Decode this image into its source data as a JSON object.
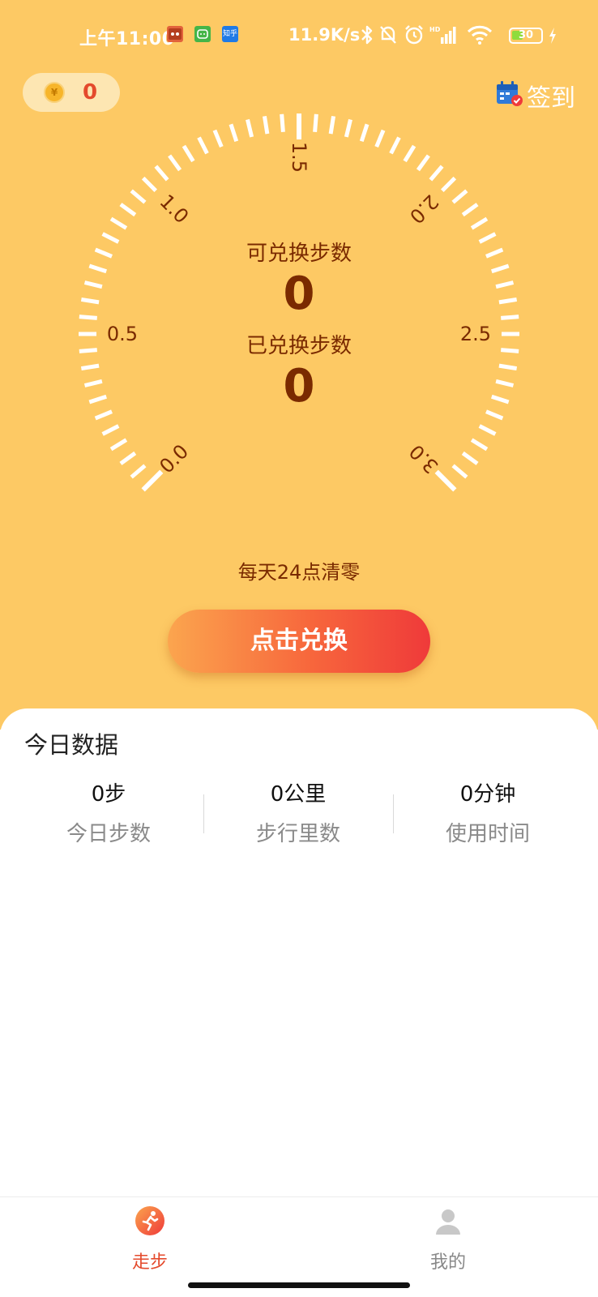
{
  "status_bar": {
    "time": "上午11:00",
    "net_speed": "11.9K/s",
    "battery": "30",
    "app_icons": [
      "app-icon-1",
      "app-icon-2",
      "zhihu-icon"
    ],
    "zhihu_text": "知乎"
  },
  "header": {
    "coin_symbol": "¥",
    "coin_count": "0",
    "signin_label": "签到"
  },
  "gauge": {
    "scale_labels": [
      "0.0",
      "0.5",
      "1.0",
      "1.5",
      "2.0",
      "2.5",
      "3.0"
    ],
    "available_label": "可兑换步数",
    "available_value": "0",
    "exchanged_label": "已兑换步数",
    "exchanged_value": "0",
    "reset_note": "每天24点清零"
  },
  "exchange_button": {
    "label": "点击兑换"
  },
  "today": {
    "title": "今日数据",
    "stats": [
      {
        "value": "0步",
        "label": "今日步数"
      },
      {
        "value": "0公里",
        "label": "步行里数"
      },
      {
        "value": "0分钟",
        "label": "使用时间"
      }
    ]
  },
  "nav": {
    "items": [
      {
        "label": "走步",
        "active": true
      },
      {
        "label": "我的",
        "active": false
      }
    ]
  },
  "colors": {
    "background_top": "#fdc964",
    "accent_red": "#e44a2c",
    "gauge_text": "#7a2a00",
    "button_gradient": [
      "#fba54e",
      "#ef3a3a"
    ]
  }
}
